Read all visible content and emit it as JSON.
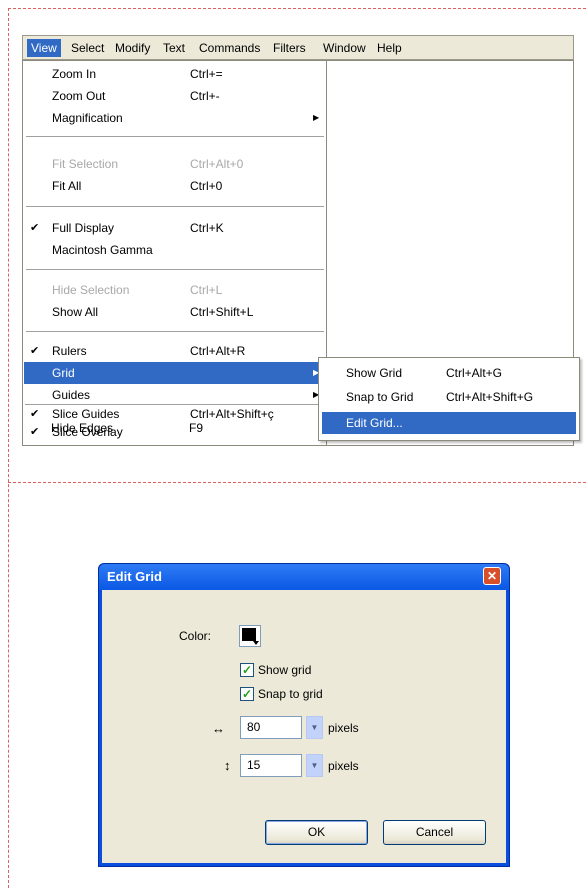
{
  "menubar": {
    "items": [
      "View",
      "Select",
      "Modify",
      "Text",
      "Commands",
      "Filters",
      "Window",
      "Help"
    ]
  },
  "view_menu": {
    "items": [
      {
        "label": "Zoom In",
        "shortcut": "Ctrl+="
      },
      {
        "label": "Zoom Out",
        "shortcut": "Ctrl+-"
      },
      {
        "label": "Magnification",
        "shortcut": ""
      },
      {
        "label": "Fit Selection",
        "shortcut": "Ctrl+Alt+0"
      },
      {
        "label": "Fit All",
        "shortcut": "Ctrl+0"
      },
      {
        "label": "Full Display",
        "shortcut": "Ctrl+K",
        "check": "✔"
      },
      {
        "label": "Macintosh Gamma",
        "shortcut": ""
      },
      {
        "label": "Hide Selection",
        "shortcut": "Ctrl+L"
      },
      {
        "label": "Show All",
        "shortcut": "Ctrl+Shift+L"
      },
      {
        "label": "Rulers",
        "shortcut": "Ctrl+Alt+R",
        "check": "✔"
      },
      {
        "label": "Grid",
        "shortcut": ""
      },
      {
        "label": "Guides",
        "shortcut": ""
      },
      {
        "label": "Slice Guides",
        "shortcut": "Ctrl+Alt+Shift+ç",
        "check": "✔"
      },
      {
        "label": "Slice Overlay",
        "shortcut": "",
        "check": "✔"
      },
      {
        "label": "Hide Edges",
        "shortcut": "F9"
      }
    ]
  },
  "grid_submenu": {
    "items": [
      {
        "label": "Show Grid",
        "shortcut": "Ctrl+Alt+G"
      },
      {
        "label": "Snap to Grid",
        "shortcut": "Ctrl+Alt+Shift+G"
      },
      {
        "label": "Edit Grid...",
        "shortcut": ""
      }
    ]
  },
  "dialog": {
    "title": "Edit Grid",
    "close_glyph": "✕",
    "color_label": "Color:",
    "swatch_color": "#000000",
    "show_grid_label": "Show grid",
    "snap_to_grid_label": "Snap to grid",
    "show_grid_checked": true,
    "snap_to_grid_checked": true,
    "h_arrow": "↔",
    "v_arrow": "↕",
    "h_value": "80",
    "v_value": "15",
    "unit": "pixels",
    "ok_label": "OK",
    "cancel_label": "Cancel",
    "check_glyph": "✓",
    "dropdown_glyph": "▼"
  }
}
